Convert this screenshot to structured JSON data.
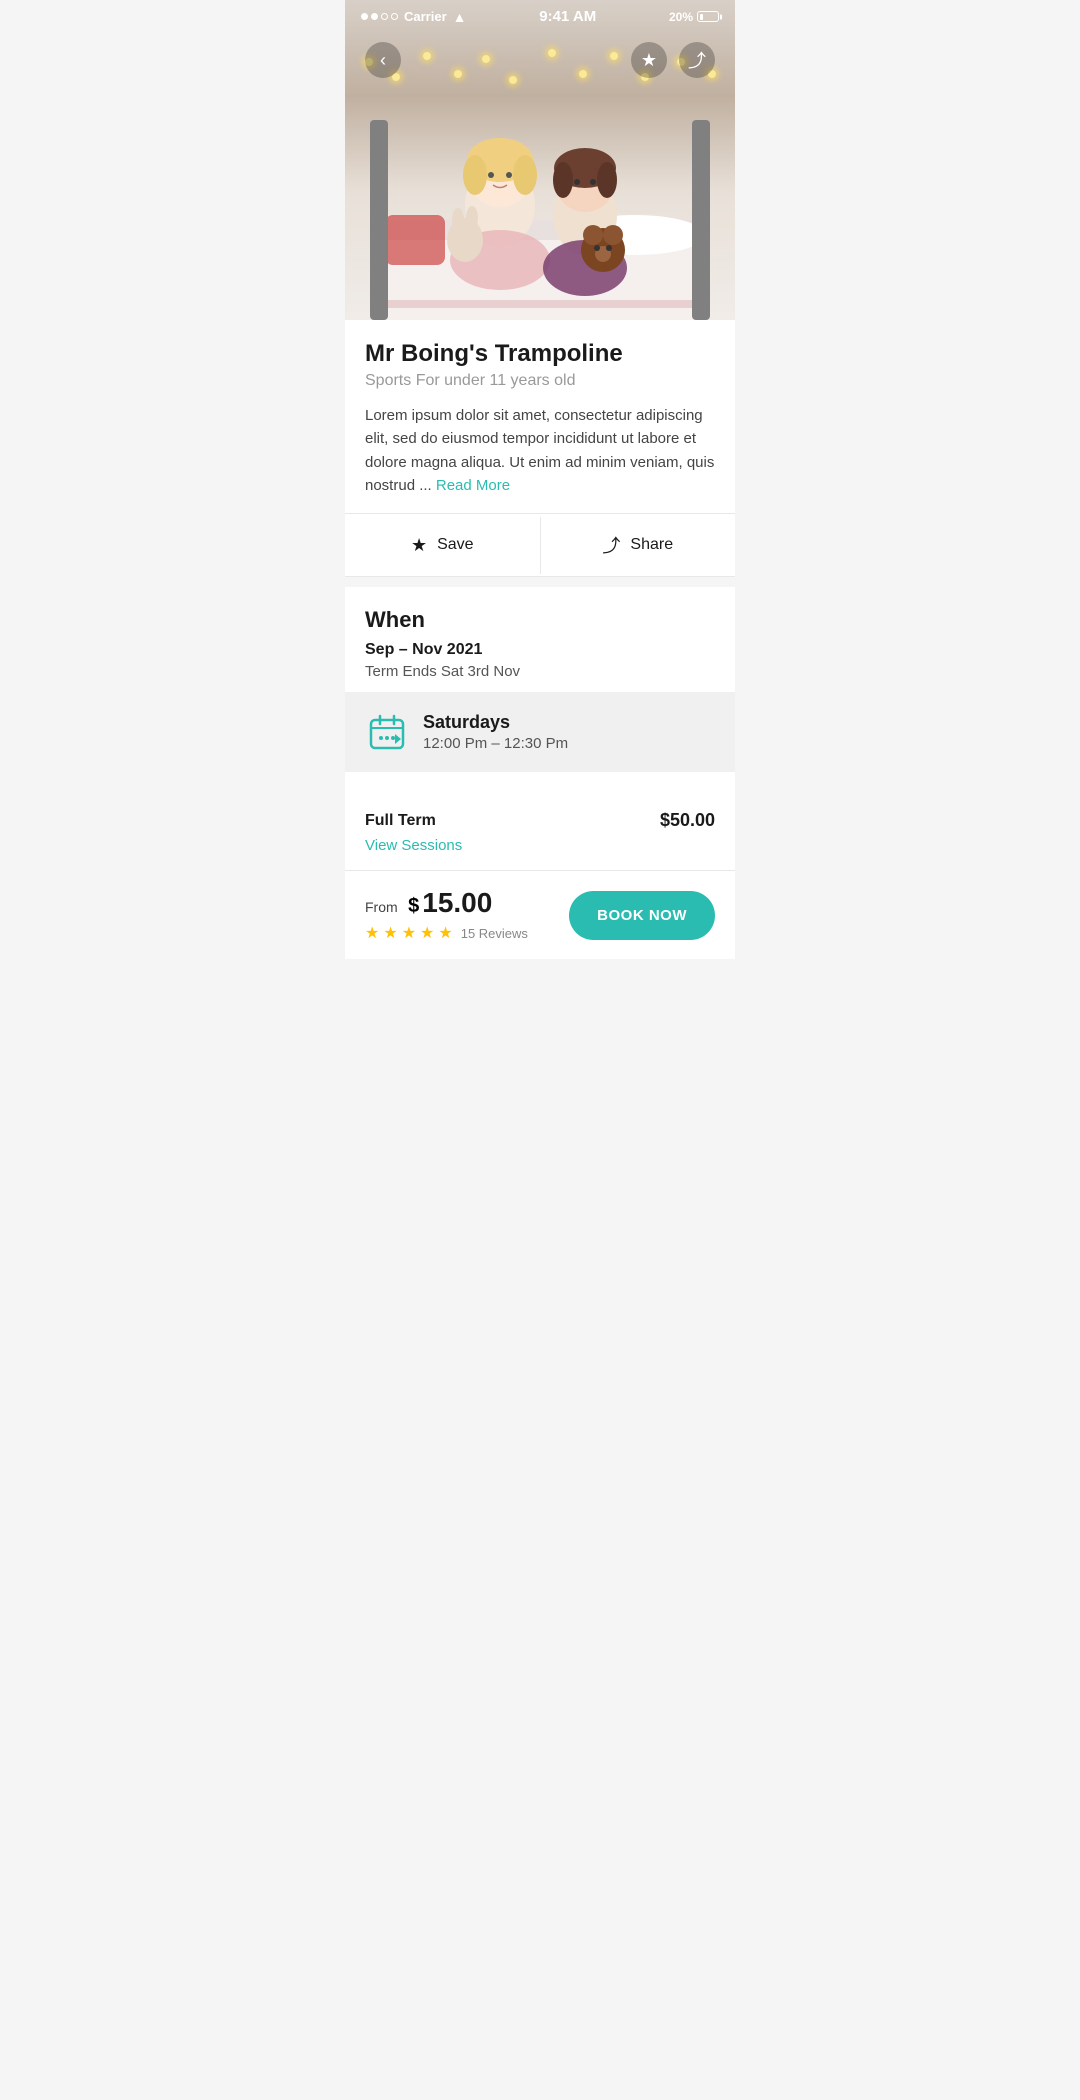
{
  "statusBar": {
    "carrier": "Carrier",
    "time": "9:41 AM",
    "battery": "20%",
    "signal": [
      "filled",
      "filled",
      "empty",
      "empty"
    ]
  },
  "nav": {
    "backIcon": "‹",
    "bookmarkIcon": "★",
    "shareIcon": "⤴"
  },
  "venue": {
    "title": "Mr Boing's Trampoline",
    "subtitle": "Sports For under 11 years old",
    "description": "Lorem ipsum dolor sit amet, consectetur adipiscing elit, sed do eiusmod tempor incididunt ut labore et dolore magna aliqua. Ut enim ad minim veniam, quis nostrud ...",
    "readMoreLabel": "Read More"
  },
  "actions": {
    "saveLabel": "Save",
    "shareLabel": "Share",
    "saveIcon": "★",
    "shareIcon": "⤴"
  },
  "when": {
    "sectionTitle": "When",
    "dateRange": "Sep – Nov 2021",
    "termEnds": "Term Ends Sat 3rd Nov"
  },
  "schedule": {
    "dayName": "Saturdays",
    "timeRange": "12:00 Pm – 12:30 Pm"
  },
  "pricing": {
    "fullTermLabel": "Full Term",
    "fullTermPrice": "$50.00",
    "viewSessionsLabel": "View Sessions"
  },
  "bottomBar": {
    "fromLabel": "From",
    "currencySymbol": "$",
    "price": "15.00",
    "stars": [
      1,
      2,
      3,
      4,
      5
    ],
    "reviewsLabel": "15 Reviews",
    "bookNowLabel": "BOOK NOW"
  },
  "colors": {
    "teal": "#2abcb0",
    "star": "#FFC107",
    "lightBg": "#f0f0f0"
  }
}
